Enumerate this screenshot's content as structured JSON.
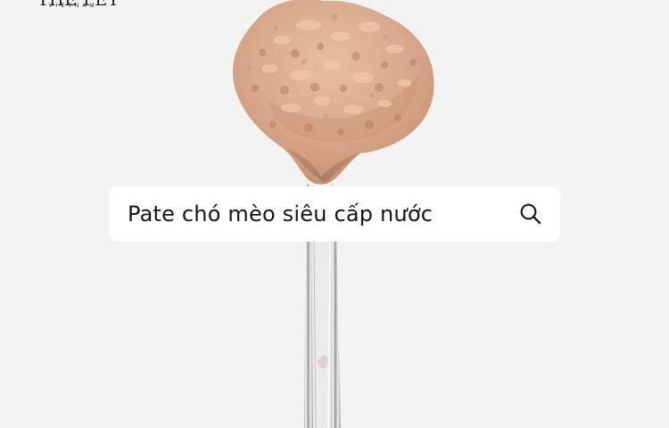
{
  "logo": {
    "main": "THE PET",
    "sub": "VIETNAM"
  },
  "search": {
    "query": "Pate chó mèo siêu cấp nước",
    "icon": "search-icon"
  },
  "colors": {
    "background": "#f3f3f3",
    "search_background": "#ffffff",
    "text": "#151515",
    "pate": "#d8a98b"
  }
}
